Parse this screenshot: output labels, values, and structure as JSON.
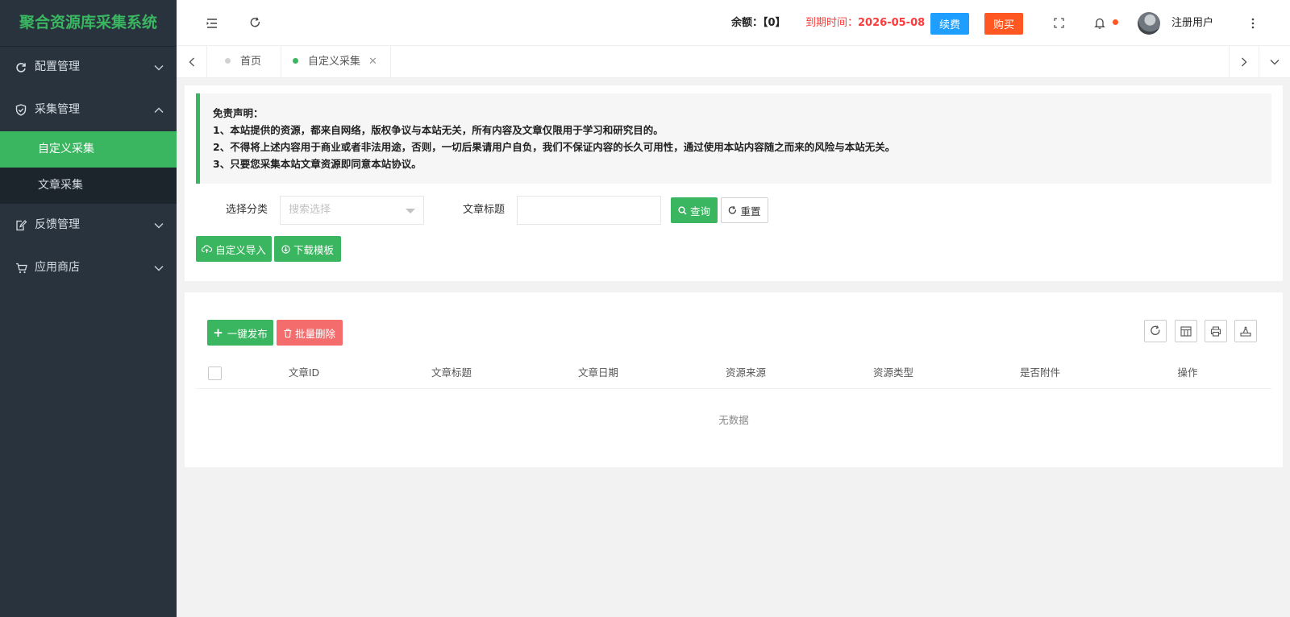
{
  "sidebar": {
    "logo": "聚合资源库采集系统",
    "menu": [
      {
        "label": "配置管理",
        "icon": "refresh-icon"
      },
      {
        "label": "采集管理",
        "icon": "shield-check-icon"
      },
      {
        "label": "反馈管理",
        "icon": "edit-doc-icon"
      },
      {
        "label": "应用商店",
        "icon": "cart-icon"
      }
    ],
    "submenu": [
      {
        "label": "自定义采集",
        "active": true
      },
      {
        "label": "文章采集",
        "active": false
      }
    ]
  },
  "header": {
    "balance": "余额：【0】",
    "expire_label": "到期时间：",
    "expire_value": "2026-05-08",
    "renew_label": "续费",
    "buy_label": "购买",
    "username": "注册用户"
  },
  "tabs": [
    {
      "label": "首页",
      "active": false
    },
    {
      "label": "自定义采集",
      "active": true
    }
  ],
  "notice": {
    "title": "免责声明：",
    "lines": [
      "1、本站提供的资源，都来自网络，版权争议与本站无关，所有内容及文章仅限用于学习和研究目的。",
      "2、不得将上述内容用于商业或者非法用途，否则，一切后果请用户自负，我们不保证内容的长久可用性，通过使用本站内容随之而来的风险与本站无关。",
      "3、只要您采集本站文章资源即同意本站协议。"
    ]
  },
  "filters": {
    "category_label": "选择分类",
    "category_placeholder": "搜索选择",
    "title_label": "文章标题",
    "query_label": "查询",
    "reset_label": "重置",
    "import_label": "自定义导入",
    "template_label": "下载模板"
  },
  "table": {
    "publish_label": "一键发布",
    "batch_delete_label": "批量删除",
    "columns": [
      "文章ID",
      "文章标题",
      "文章日期",
      "资源来源",
      "资源类型",
      "是否附件",
      "操作"
    ],
    "empty_text": "无数据"
  },
  "colors": {
    "accent": "#3ab560",
    "sidebar_bg": "#28333e",
    "renew": "#1e9fff",
    "buy": "#ff5722",
    "danger": "#f56c6c",
    "expire_text": "#ff3a3a"
  }
}
